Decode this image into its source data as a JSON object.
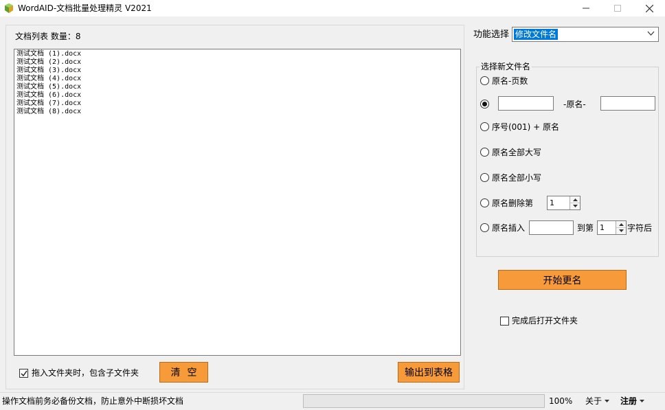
{
  "window": {
    "title": "WordAID-文档批量处理精灵 V2021"
  },
  "doc_panel": {
    "count_label": "文档列表  数量：8",
    "files": [
      "测试文档 (1).docx",
      "测试文档 (2).docx",
      "测试文档 (3).docx",
      "测试文档 (4).docx",
      "测试文档 (5).docx",
      "测试文档 (6).docx",
      "测试文档 (7).docx",
      "测试文档 (8).docx"
    ],
    "include_subfolders_label": "拖入文件夹时，包含子文件夹",
    "include_subfolders_checked": true,
    "clear_label": "清空",
    "export_label": "输出到表格"
  },
  "function": {
    "label": "功能选择",
    "selected": "修改文件名"
  },
  "rename": {
    "group_title": "选择新文件名",
    "selected_index": 1,
    "opt_page_count": "原名-页数",
    "opt_custom_middle": "-原名-",
    "opt_prefix": "",
    "opt_suffix": "",
    "opt_serial": "序号(001) + 原名",
    "opt_upper": "原名全部大写",
    "opt_lower": "原名全部小写",
    "opt_delete": "原名删除第",
    "delete_value": "1",
    "opt_insert": "原名插入",
    "insert_text": "",
    "insert_to": "到第",
    "insert_pos": "1",
    "insert_after": "字符后"
  },
  "start_label": "开始更名",
  "open_folder_label": "完成后打开文件夹",
  "open_folder_checked": false,
  "status": {
    "message": "操作文档前务必备份文档，防止意外中断损坏文档",
    "zoom": "100%",
    "about": "关于",
    "register": "注册"
  },
  "colors": {
    "button": "#f79a3a",
    "selection": "#0078d7"
  }
}
